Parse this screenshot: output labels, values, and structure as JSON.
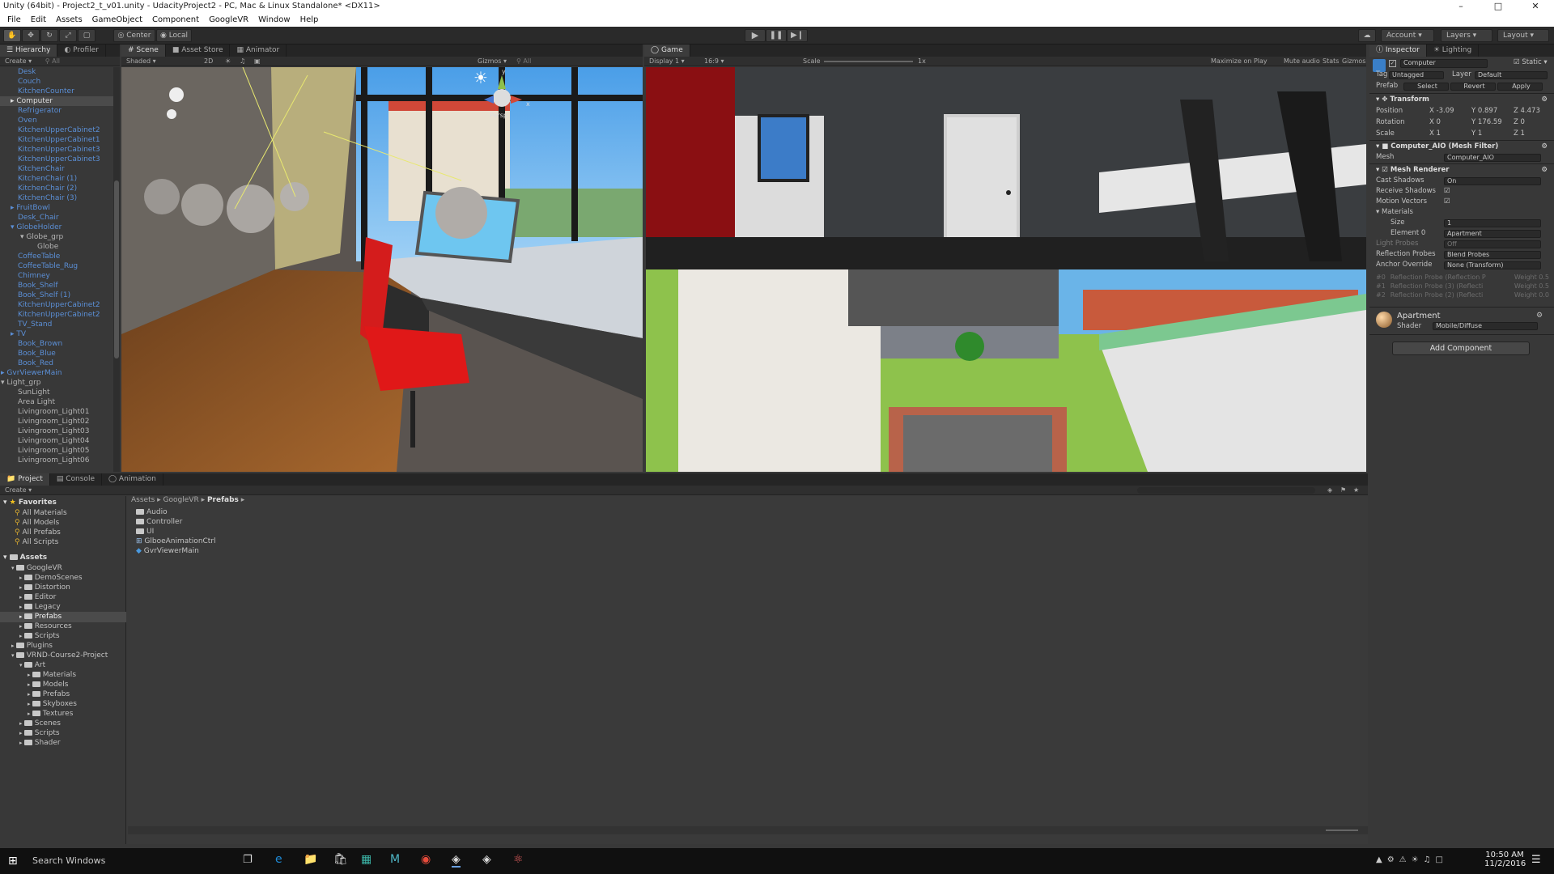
{
  "window": {
    "title": "Unity (64bit) - Project2_t_v01.unity - UdacityProject2 - PC, Mac & Linux Standalone* <DX11>"
  },
  "menu": [
    "File",
    "Edit",
    "Assets",
    "GameObject",
    "Component",
    "GoogleVR",
    "Window",
    "Help"
  ],
  "toolbar": {
    "center": "Center",
    "local": "Local",
    "account": "Account",
    "layers": "Layers",
    "layout": "Layout"
  },
  "hierarchy": {
    "tabs": [
      "Hierarchy",
      "Profiler"
    ],
    "create": "Create",
    "search_placeholder": "All",
    "items": [
      {
        "label": "Desk",
        "indent": 1,
        "color": "blue"
      },
      {
        "label": "Couch",
        "indent": 1,
        "color": "blue"
      },
      {
        "label": "KitchenCounter",
        "indent": 1,
        "color": "blue"
      },
      {
        "label": "Computer",
        "indent": 1,
        "color": "grey",
        "selected": true,
        "arrow": true
      },
      {
        "label": "Refrigerator",
        "indent": 1,
        "color": "blue"
      },
      {
        "label": "Oven",
        "indent": 1,
        "color": "blue"
      },
      {
        "label": "KitchenUpperCabinet2",
        "indent": 1,
        "color": "blue"
      },
      {
        "label": "KitchenUpperCabinet1",
        "indent": 1,
        "color": "blue"
      },
      {
        "label": "KitchenUpperCabinet3",
        "indent": 1,
        "color": "blue"
      },
      {
        "label": "KitchenUpperCabinet3",
        "indent": 1,
        "color": "blue"
      },
      {
        "label": "KitchenChair",
        "indent": 1,
        "color": "blue"
      },
      {
        "label": "KitchenChair (1)",
        "indent": 1,
        "color": "blue"
      },
      {
        "label": "KitchenChair (2)",
        "indent": 1,
        "color": "blue"
      },
      {
        "label": "KitchenChair (3)",
        "indent": 1,
        "color": "blue"
      },
      {
        "label": "FruitBowl",
        "indent": 1,
        "color": "blue",
        "arrow": true
      },
      {
        "label": "Desk_Chair",
        "indent": 1,
        "color": "blue"
      },
      {
        "label": "GlobeHolder",
        "indent": 1,
        "color": "blue",
        "arrow": true,
        "open": true
      },
      {
        "label": "Globe_grp",
        "indent": 2,
        "color": "grey",
        "arrow": true,
        "open": true
      },
      {
        "label": "Globe",
        "indent": 3,
        "color": "grey"
      },
      {
        "label": "CoffeeTable",
        "indent": 1,
        "color": "blue"
      },
      {
        "label": "CoffeeTable_Rug",
        "indent": 1,
        "color": "blue"
      },
      {
        "label": "Chimney",
        "indent": 1,
        "color": "blue"
      },
      {
        "label": "Book_Shelf",
        "indent": 1,
        "color": "blue"
      },
      {
        "label": "Book_Shelf (1)",
        "indent": 1,
        "color": "blue"
      },
      {
        "label": "KitchenUpperCabinet2",
        "indent": 1,
        "color": "blue"
      },
      {
        "label": "KitchenUpperCabinet2",
        "indent": 1,
        "color": "blue"
      },
      {
        "label": "TV_Stand",
        "indent": 1,
        "color": "blue"
      },
      {
        "label": "TV",
        "indent": 1,
        "color": "blue",
        "arrow": true
      },
      {
        "label": "Book_Brown",
        "indent": 1,
        "color": "blue"
      },
      {
        "label": "Book_Blue",
        "indent": 1,
        "color": "blue"
      },
      {
        "label": "Book_Red",
        "indent": 1,
        "color": "blue"
      },
      {
        "label": "GvrViewerMain",
        "indent": 0,
        "color": "blue",
        "arrow": true
      },
      {
        "label": "Light_grp",
        "indent": 0,
        "color": "grey",
        "arrow": true,
        "open": true
      },
      {
        "label": "SunLight",
        "indent": 1,
        "color": "grey"
      },
      {
        "label": "Area Light",
        "indent": 1,
        "color": "grey"
      },
      {
        "label": "Livingroom_Light01",
        "indent": 1,
        "color": "grey"
      },
      {
        "label": "Livingroom_Light02",
        "indent": 1,
        "color": "grey"
      },
      {
        "label": "Livingroom_Light03",
        "indent": 1,
        "color": "grey"
      },
      {
        "label": "Livingroom_Light04",
        "indent": 1,
        "color": "grey"
      },
      {
        "label": "Livingroom_Light05",
        "indent": 1,
        "color": "grey"
      },
      {
        "label": "Livingroom_Light06",
        "indent": 1,
        "color": "grey"
      }
    ]
  },
  "scene": {
    "tabs": [
      "Scene",
      "Asset Store",
      "Animator"
    ],
    "shading": "Shaded",
    "mode2d": "2D",
    "gizmos": "Gizmos",
    "search_placeholder": "All",
    "persp": "Persp",
    "axis_y": "y",
    "axis_x": "x"
  },
  "game": {
    "tab": "Game",
    "display": "Display 1",
    "aspect": "16:9",
    "scale_label": "Scale",
    "scale_value": "1x",
    "maximize": "Maximize on Play",
    "mute": "Mute audio",
    "stats": "Stats",
    "gizmos": "Gizmos"
  },
  "inspector": {
    "tabs": [
      "Inspector",
      "Lighting"
    ],
    "object_name": "Computer",
    "static_label": "Static",
    "tag_label": "Tag",
    "tag_value": "Untagged",
    "layer_label": "Layer",
    "layer_value": "Default",
    "prefab_label": "Prefab",
    "prefab_select": "Select",
    "prefab_revert": "Revert",
    "prefab_apply": "Apply",
    "transform": {
      "header": "Transform",
      "position_label": "Position",
      "position": {
        "x": "-3.09",
        "y": "0.897",
        "z": "4.473"
      },
      "rotation_label": "Rotation",
      "rotation": {
        "x": "0",
        "y": "176.59",
        "z": "0"
      },
      "scale_label": "Scale",
      "scale": {
        "x": "1",
        "y": "1",
        "z": "1"
      }
    },
    "mesh_filter": {
      "header": "Computer_AIO (Mesh Filter)",
      "mesh_label": "Mesh",
      "mesh_value": "Computer_AIO"
    },
    "mesh_renderer": {
      "header": "Mesh Renderer",
      "cast_shadows_label": "Cast Shadows",
      "cast_shadows_value": "On",
      "receive_shadows_label": "Receive Shadows",
      "motion_vectors_label": "Motion Vectors",
      "materials_label": "Materials",
      "size_label": "Size",
      "size_value": "1",
      "element0_label": "Element 0",
      "element0_value": "Apartment",
      "light_probes_label": "Light Probes",
      "light_probes_value": "Off",
      "reflection_probes_label": "Reflection Probes",
      "reflection_probes_value": "Blend Probes",
      "anchor_label": "Anchor Override",
      "anchor_value": "None (Transform)",
      "probes": [
        {
          "index": "#0",
          "name": "Reflection Probe (Reflection P",
          "weight": "Weight 0.5"
        },
        {
          "index": "#1",
          "name": "Reflection Probe (3) (Reflecti",
          "weight": "Weight 0.5"
        },
        {
          "index": "#2",
          "name": "Reflection Probe (2) (Reflecti",
          "weight": "Weight 0.0"
        }
      ]
    },
    "material": {
      "name": "Apartment",
      "shader_label": "Shader",
      "shader_value": "Mobile/Diffuse"
    },
    "add_component": "Add Component"
  },
  "project": {
    "tabs": [
      "Project",
      "Console",
      "Animation"
    ],
    "create": "Create",
    "favorites_label": "Favorites",
    "favorites": [
      "All Materials",
      "All Models",
      "All Prefabs",
      "All Scripts"
    ],
    "assets_label": "Assets",
    "tree": [
      {
        "label": "GoogleVR",
        "indent": 1,
        "open": true
      },
      {
        "label": "DemoScenes",
        "indent": 2
      },
      {
        "label": "Distortion",
        "indent": 2
      },
      {
        "label": "Editor",
        "indent": 2
      },
      {
        "label": "Legacy",
        "indent": 2
      },
      {
        "label": "Prefabs",
        "indent": 2,
        "selected": true
      },
      {
        "label": "Resources",
        "indent": 2
      },
      {
        "label": "Scripts",
        "indent": 2
      },
      {
        "label": "Plugins",
        "indent": 1
      },
      {
        "label": "VRND-Course2-Project",
        "indent": 1,
        "open": true
      },
      {
        "label": "Art",
        "indent": 2,
        "open": true
      },
      {
        "label": "Materials",
        "indent": 3
      },
      {
        "label": "Models",
        "indent": 3
      },
      {
        "label": "Prefabs",
        "indent": 3
      },
      {
        "label": "Skyboxes",
        "indent": 3
      },
      {
        "label": "Textures",
        "indent": 3
      },
      {
        "label": "Scenes",
        "indent": 2
      },
      {
        "label": "Scripts",
        "indent": 2
      },
      {
        "label": "Shader",
        "indent": 2
      }
    ],
    "breadcrumb": [
      "Assets",
      "GoogleVR",
      "Prefabs"
    ],
    "files": [
      {
        "label": "Audio",
        "type": "folder"
      },
      {
        "label": "Controller",
        "type": "folder"
      },
      {
        "label": "UI",
        "type": "folder"
      },
      {
        "label": "GlboeAnimationCtrl",
        "type": "anim"
      },
      {
        "label": "GvrViewerMain",
        "type": "prefab"
      }
    ]
  },
  "taskbar": {
    "search_placeholder": "Search Windows",
    "time": "10:50 AM",
    "date": "11/2/2016"
  },
  "colors": {
    "blue_text": "#5b8fd6",
    "selected": "#4b4b4b",
    "accent": "#3a72b0"
  }
}
